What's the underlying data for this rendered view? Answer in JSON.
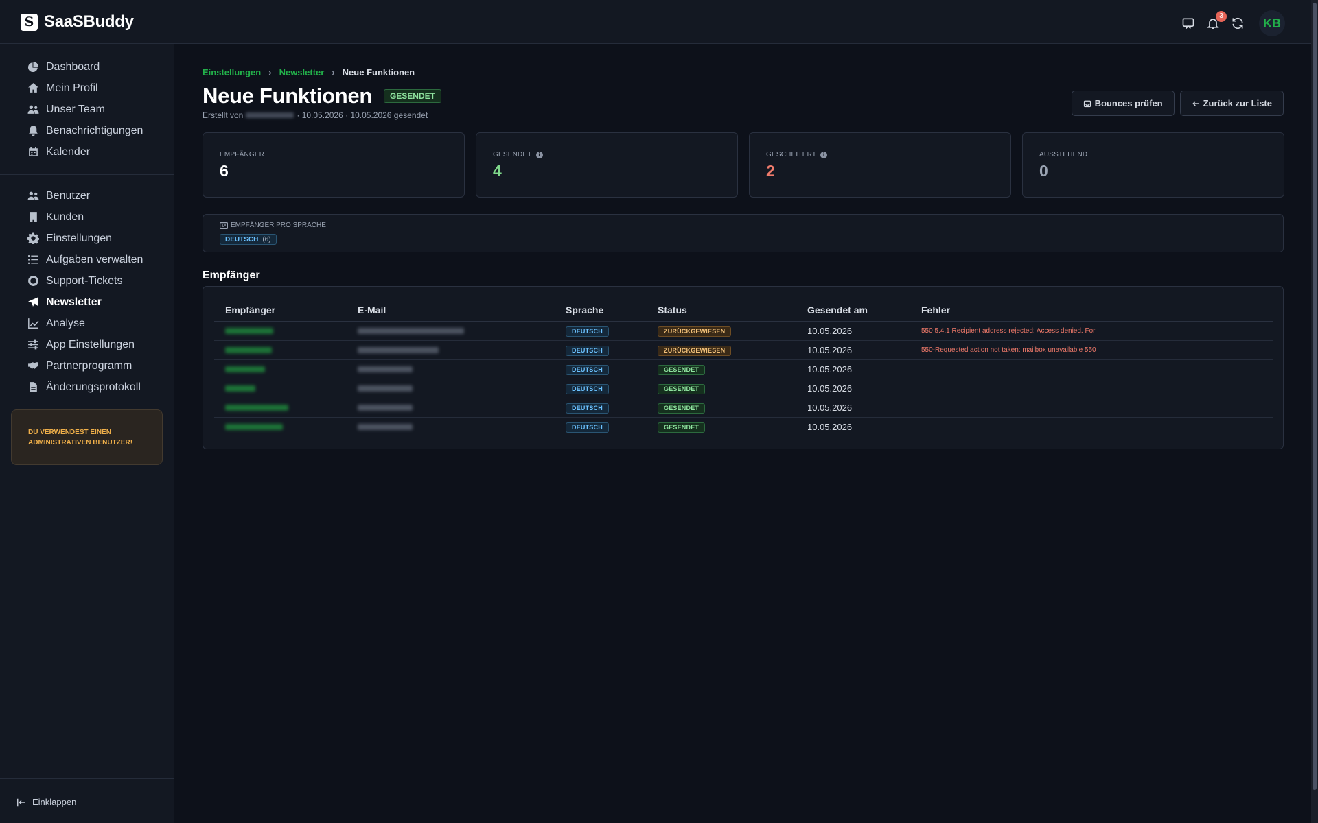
{
  "app": {
    "name": "SaaSBuddy",
    "logo_letter": "S"
  },
  "topbar": {
    "notification_count": "3",
    "avatar_initials": "KB"
  },
  "sidebar": {
    "group1": [
      {
        "label": "Dashboard",
        "icon": "pie-chart-icon"
      },
      {
        "label": "Mein Profil",
        "icon": "home-icon"
      },
      {
        "label": "Unser Team",
        "icon": "users-icon"
      },
      {
        "label": "Benachrichtigungen",
        "icon": "bell-icon"
      },
      {
        "label": "Kalender",
        "icon": "calendar-icon"
      }
    ],
    "group2": [
      {
        "label": "Benutzer",
        "icon": "users-icon"
      },
      {
        "label": "Kunden",
        "icon": "building-icon"
      },
      {
        "label": "Einstellungen",
        "icon": "gear-icon"
      },
      {
        "label": "Aufgaben verwalten",
        "icon": "tasks-icon"
      },
      {
        "label": "Support-Tickets",
        "icon": "lifebuoy-icon"
      },
      {
        "label": "Newsletter",
        "icon": "paper-plane-icon",
        "active": true
      },
      {
        "label": "Analyse",
        "icon": "line-chart-icon"
      },
      {
        "label": "App Einstellungen",
        "icon": "sliders-icon"
      },
      {
        "label": "Partnerprogramm",
        "icon": "handshake-icon"
      },
      {
        "label": "Änderungsprotokoll",
        "icon": "file-icon"
      }
    ],
    "admin_notice": "DU VERWENDEST EINEN ADMINISTRATIVEN BENUTZER!",
    "collapse_label": "Einklappen"
  },
  "breadcrumb": {
    "items": [
      "Einstellungen",
      "Newsletter"
    ],
    "current": "Neue Funktionen"
  },
  "page": {
    "title": "Neue Funktionen",
    "status_badge": "GESENDET",
    "subtitle_prefix": "Erstellt von",
    "subtitle_suffix": "· 10.05.2026 · 10.05.2026 gesendet",
    "btn_bounces": "Bounces prüfen",
    "btn_back": "Zurück zur Liste"
  },
  "stats": [
    {
      "label": "EMPFÄNGER",
      "value": "6",
      "color": "#ffffff",
      "info": false
    },
    {
      "label": "GESENDET",
      "value": "4",
      "color": "#7fd88b",
      "info": true
    },
    {
      "label": "GESCHEITERT",
      "value": "2",
      "color": "#ef7b6c",
      "info": true
    },
    {
      "label": "AUSSTEHEND",
      "value": "0",
      "color": "#9aa3b2",
      "info": false
    }
  ],
  "language_box": {
    "label": "EMPFÄNGER PRO SPRACHE",
    "chip_name": "DEUTSCH",
    "chip_count": "(6)"
  },
  "recipients": {
    "title": "Empfänger",
    "columns": [
      "Empfänger",
      "E-Mail",
      "Sprache",
      "Status",
      "Gesendet am",
      "Fehler"
    ],
    "rows": [
      {
        "language": "DEUTSCH",
        "status": "ZURÜCKGEWIESEN",
        "status_kind": "bounce",
        "sent": "10.05.2026",
        "error": "550 5.4.1 Recipient address rejected: Access denied. For"
      },
      {
        "language": "DEUTSCH",
        "status": "ZURÜCKGEWIESEN",
        "status_kind": "bounce",
        "sent": "10.05.2026",
        "error": "550-Requested action not taken: mailbox unavailable 550"
      },
      {
        "language": "DEUTSCH",
        "status": "GESENDET",
        "status_kind": "sent",
        "sent": "10.05.2026",
        "error": ""
      },
      {
        "language": "DEUTSCH",
        "status": "GESENDET",
        "status_kind": "sent",
        "sent": "10.05.2026",
        "error": ""
      },
      {
        "language": "DEUTSCH",
        "status": "GESENDET",
        "status_kind": "sent",
        "sent": "10.05.2026",
        "error": ""
      },
      {
        "language": "DEUTSCH",
        "status": "GESENDET",
        "status_kind": "sent",
        "sent": "10.05.2026",
        "error": ""
      }
    ]
  }
}
